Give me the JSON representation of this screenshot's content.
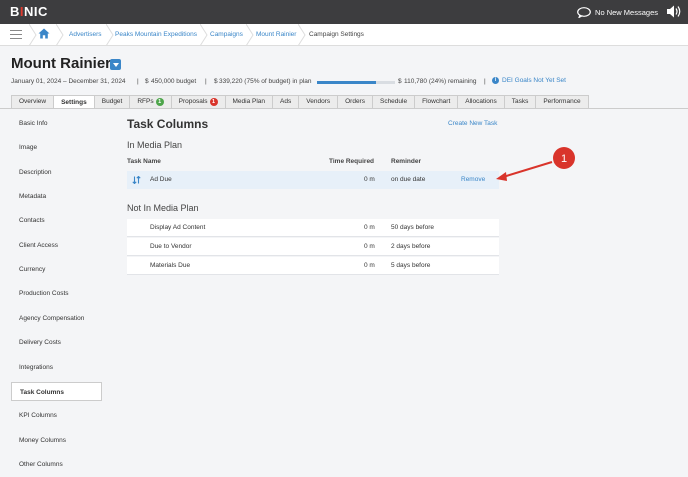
{
  "app": {
    "logo_b": "B",
    "logo_rest": "NIC",
    "messages": "No New Messages"
  },
  "breadcrumb": [
    "Advertisers",
    "Peaks Mountain Expeditions",
    "Campaigns",
    "Mount Rainier",
    "Campaign Settings"
  ],
  "campaign": {
    "title": "Mount Rainier",
    "dates": "January 01, 2024 – December 31, 2024",
    "budget_currency": "$",
    "budget": "450,000 budget",
    "plan_currency": "$",
    "plan": "339,220 (75% of budget) in plan",
    "plan_fraction": 0.75,
    "remaining_currency": "$",
    "remaining": "110,780 (24%) remaining",
    "dei": "DEI Goals Not Yet Set",
    "dei_icon": "info-icon"
  },
  "tabs": [
    {
      "label": "Overview"
    },
    {
      "label": "Settings",
      "active": true
    },
    {
      "label": "Budget"
    },
    {
      "label": "RFPs",
      "badge": "1",
      "badge_color": "#4ea54b"
    },
    {
      "label": "Proposals",
      "badge": "1",
      "badge_color": "#d9342b"
    },
    {
      "label": "Media Plan"
    },
    {
      "label": "Ads"
    },
    {
      "label": "Vendors"
    },
    {
      "label": "Orders"
    },
    {
      "label": "Schedule"
    },
    {
      "label": "Flowchart"
    },
    {
      "label": "Allocations"
    },
    {
      "label": "Tasks"
    },
    {
      "label": "Performance"
    }
  ],
  "sidebar": [
    "Basic Info",
    "Image",
    "Description",
    "Metadata",
    "Contacts",
    "Client Access",
    "Currency",
    "Production Costs",
    "Agency Compensation",
    "Delivery Costs",
    "Integrations",
    "Task Columns",
    "KPI Columns",
    "Money Columns",
    "Other Columns"
  ],
  "sidebar_selected": "Task Columns",
  "main": {
    "heading": "Task Columns",
    "create_link": "Create New Task",
    "in_plan_heading": "In Media Plan",
    "columns": {
      "name": "Task Name",
      "time": "Time Required",
      "reminder": "Reminder"
    },
    "in_plan": [
      {
        "name": "Ad Due",
        "time": "0 m",
        "reminder": "on due date",
        "action": "Remove"
      }
    ],
    "not_in_plan_heading": "Not In Media Plan",
    "not_in_plan": [
      {
        "name": "Display Ad Content",
        "time": "0 m",
        "reminder": "50 days before"
      },
      {
        "name": "Due to Vendor",
        "time": "0 m",
        "reminder": "2 days before"
      },
      {
        "name": "Materials Due",
        "time": "0 m",
        "reminder": "5 days before"
      }
    ]
  },
  "callout": {
    "number": "1"
  },
  "colors": {
    "accent": "#3a86c8",
    "topbar": "#3d3d3f",
    "callout": "#d9342b"
  }
}
